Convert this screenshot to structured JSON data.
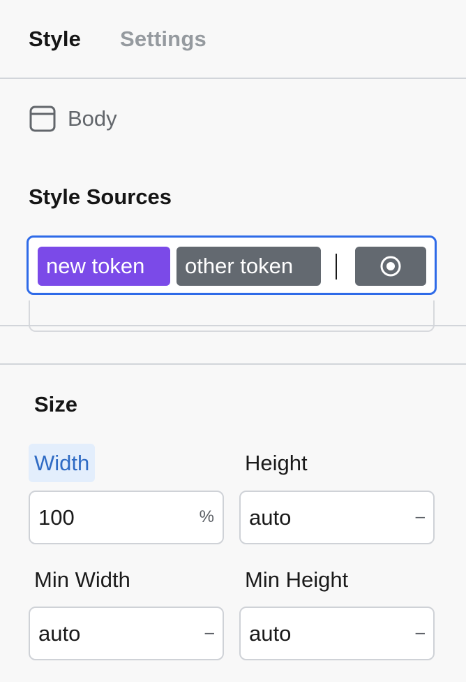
{
  "tabs": {
    "style": "Style",
    "settings": "Settings"
  },
  "element": {
    "label": "Body",
    "icon": "body-frame-icon"
  },
  "style_sources": {
    "title": "Style Sources",
    "tokens": [
      {
        "label": "new token",
        "color": "#7b4ae8"
      },
      {
        "label": "other token",
        "color": "#636970"
      }
    ],
    "state_button_icon": "target-icon",
    "accent": "#2f6be8"
  },
  "size": {
    "title": "Size",
    "width": {
      "label": "Width",
      "value": "100",
      "unit": "%"
    },
    "height": {
      "label": "Height",
      "value": "auto",
      "unit": "–"
    },
    "min_width": {
      "label": "Min Width",
      "value": "auto",
      "unit": "–"
    },
    "min_height": {
      "label": "Min Height",
      "value": "auto",
      "unit": "–"
    }
  }
}
